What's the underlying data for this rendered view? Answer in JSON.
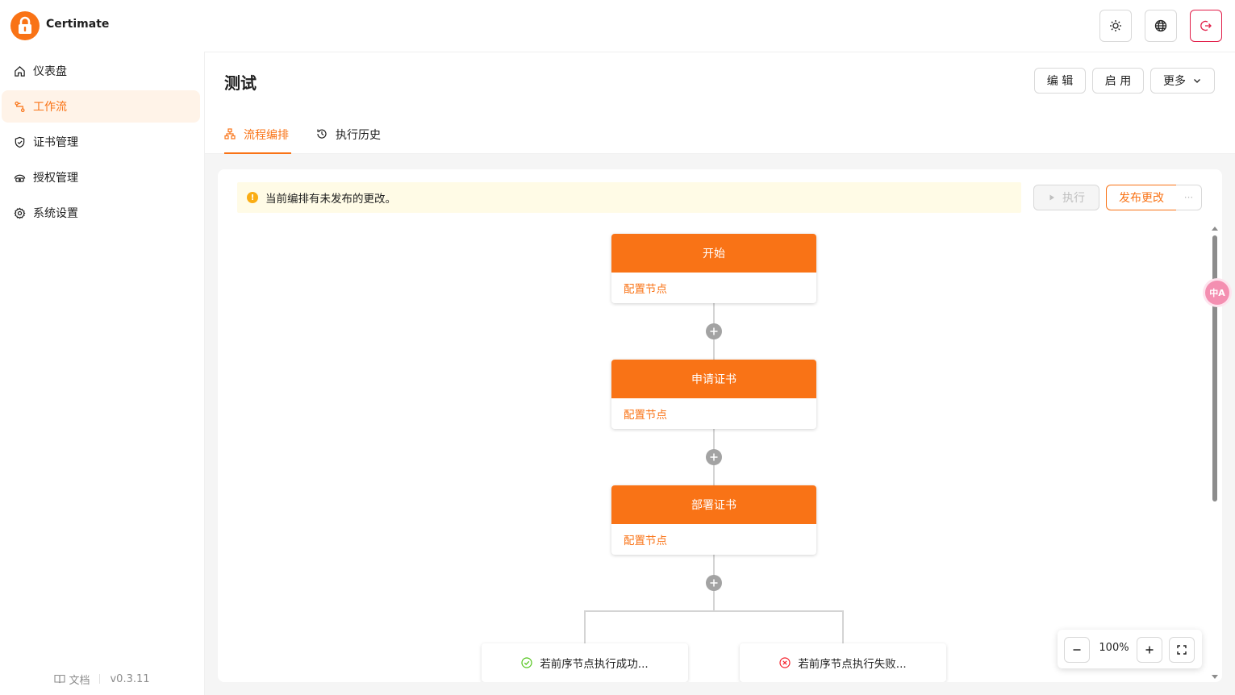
{
  "app": {
    "brand": "Certimate",
    "version": "v0.3.11",
    "docs_label": "文档"
  },
  "header_actions": {
    "theme": "sun-icon",
    "language": "globe-icon",
    "logout": "logout-icon"
  },
  "sidebar": {
    "items": [
      {
        "label": "仪表盘",
        "icon": "home-icon",
        "active": false
      },
      {
        "label": "工作流",
        "icon": "workflow-icon",
        "active": true
      },
      {
        "label": "证书管理",
        "icon": "shield-check-icon",
        "active": false
      },
      {
        "label": "授权管理",
        "icon": "key-access-icon",
        "active": false
      },
      {
        "label": "系统设置",
        "icon": "gear-icon",
        "active": false
      }
    ]
  },
  "page": {
    "title": "测试",
    "actions": {
      "edit": "编 辑",
      "enable": "启 用",
      "more": "更多"
    },
    "tabs": [
      {
        "label": "流程编排",
        "icon": "sitemap-icon",
        "active": true
      },
      {
        "label": "执行历史",
        "icon": "history-icon",
        "active": false
      }
    ]
  },
  "workflow": {
    "alert": "当前编排有未发布的更改。",
    "run_label": "执行",
    "publish_label": "发布更改",
    "more_label": "···",
    "nodes": [
      {
        "title": "开始",
        "body": "配置节点"
      },
      {
        "title": "申请证书",
        "body": "配置节点"
      },
      {
        "title": "部署证书",
        "body": "配置节点"
      }
    ],
    "branches": [
      {
        "label": "若前序节点执行成功...",
        "status": "success",
        "color": "#52c41a"
      },
      {
        "label": "若前序节点执行失败...",
        "status": "failure",
        "color": "#f5222d"
      }
    ],
    "zoom": "100%"
  },
  "colors": {
    "accent": "#f97316",
    "active_bg": "#fff3e8",
    "warning": "#faad14",
    "logout_border": "#e11d48"
  }
}
